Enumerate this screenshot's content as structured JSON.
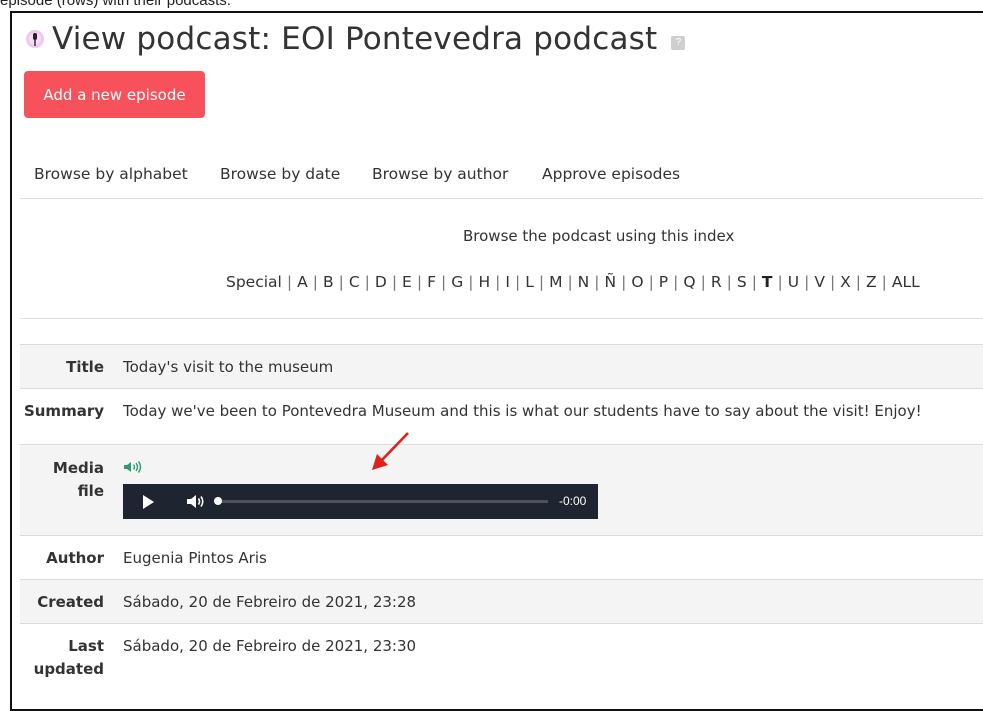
{
  "caption": "episode (rows) with their podcasts.",
  "header": {
    "title": "View podcast: EOI Pontevedra podcast",
    "help_icon": "?"
  },
  "actions": {
    "add_episode": "Add a new episode"
  },
  "tabs": [
    "Browse by alphabet",
    "Browse by date",
    "Browse by author",
    "Approve episodes"
  ],
  "browse": {
    "intro": "Browse the podcast using this index",
    "letters": [
      "Special",
      "A",
      "B",
      "C",
      "D",
      "E",
      "F",
      "G",
      "H",
      "I",
      "L",
      "M",
      "N",
      "Ñ",
      "O",
      "P",
      "Q",
      "R",
      "S",
      "T",
      "U",
      "V",
      "X",
      "Z",
      "ALL"
    ],
    "current_letter": "T"
  },
  "episode": {
    "title_label": "Title",
    "title_value": "Today's visit to the museum",
    "summary_label": "Summary",
    "summary_value": "Today we've been to Pontevedra Museum and this is what our students have to say about the visit! Enjoy!",
    "media_label_1": "Media",
    "media_label_2": "file",
    "player_time": "-0:00",
    "player_progress": 0,
    "author_label": "Author",
    "author_value": "Eugenia Pintos Aris",
    "created_label": "Created",
    "created_value": "Sábado, 20 de Febreiro de 2021, 23:28",
    "updated_label_1": "Last",
    "updated_label_2": "updated",
    "updated_value": "Sábado, 20 de Febreiro de 2021, 23:30"
  },
  "colors": {
    "accent_button": "#f7525c",
    "player_bg": "#1e2430",
    "annotation_arrow": "#e0201b",
    "speaker_icon": "#2f9e6e"
  },
  "icons": [
    "podcast-microphone-icon",
    "help-icon",
    "speaker-icon",
    "play-icon",
    "volume-icon",
    "annotation-arrow"
  ]
}
